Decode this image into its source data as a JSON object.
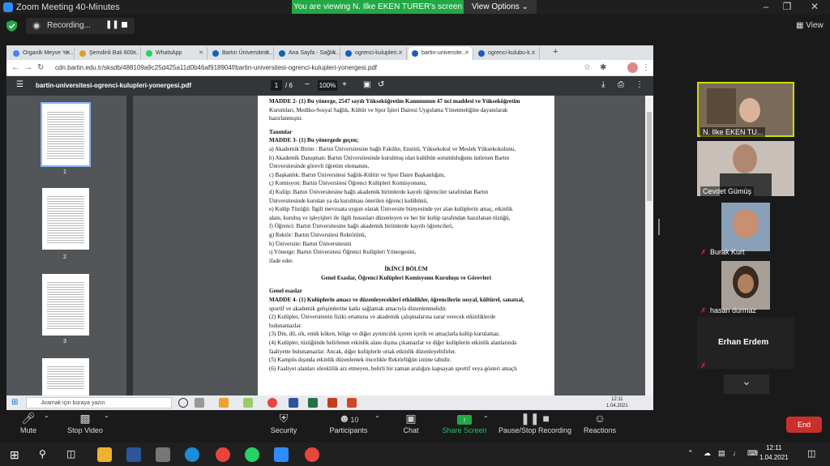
{
  "zoom": {
    "window_title": "Zoom Meeting 40-Minutes",
    "viewing_banner": "You are viewing N. Ilke EKEN TURER's screen",
    "view_options": "View Options ⌄",
    "recording_label": "Recording...",
    "view_button": "View",
    "participants_count": "10",
    "end_button": "End",
    "controls": [
      {
        "label": "Mute",
        "icon": "microphone-icon"
      },
      {
        "label": "Stop Video",
        "icon": "video-camera-icon"
      },
      {
        "label": "Security",
        "icon": "shield-icon"
      },
      {
        "label": "Participants",
        "icon": "participants-icon"
      },
      {
        "label": "Chat",
        "icon": "chat-icon"
      },
      {
        "label": "Share Screen",
        "icon": "share-screen-icon"
      },
      {
        "label": "Pause/Stop Recording",
        "icon": "recording-icon"
      },
      {
        "label": "Reactions",
        "icon": "reactions-icon"
      }
    ],
    "participants": [
      {
        "name": "N. Ilke EKEN TU..."
      },
      {
        "name": "Cevdet Gümüş"
      },
      {
        "name": "Burak Kurt"
      },
      {
        "name": "hasan durmaz"
      },
      {
        "name": "Erhan Erdem"
      }
    ]
  },
  "browser": {
    "tabs": [
      {
        "label": "Organik Meyve Ye...",
        "color": "#4285f4"
      },
      {
        "label": "Şemdinli Balı 800...",
        "color": "#e0a020"
      },
      {
        "label": "WhatsApp",
        "color": "#25d366"
      },
      {
        "label": "Bartın Üniversitesi...",
        "color": "#1a5fb4"
      },
      {
        "label": "Ana Sayfa - Sağlık...",
        "color": "#1a5fb4"
      },
      {
        "label": "ogrenci-kulupleri...",
        "color": "#1a5fb4"
      },
      {
        "label": "bartin-universite...",
        "color": "#1a5fb4"
      },
      {
        "label": "ogrenci-kulubu-k...",
        "color": "#1a5fb4"
      }
    ],
    "url": "cdn.bartin.edu.tr/sksdb/488109a9c25d425a11d0b46af918904f/bartin-universitesi-ogrenci-kulupleri-yonergesi.pdf"
  },
  "pdf": {
    "filename": "bartin-universitesi-ogrenci-kulupleri-yonergesi.pdf",
    "current_page": "1",
    "total_pages": "/ 6",
    "zoom": "100%",
    "thumb_numbers": [
      "1",
      "2",
      "3"
    ],
    "lines": [
      {
        "t": "MADDE 2- (1) Bu yönerge, 2547 sayılı Yükseköğretim Kanununun 47 nci maddesi ve Yükseköğretim",
        "s": "b"
      },
      {
        "t": "Kurumları, Mediko-Sosyal Sağlık, Kültür ve Spor İşleri Dairesi Uygulama Yönetmeliğine dayanılarak",
        "s": ""
      },
      {
        "t": "hazırlanmıştır.",
        "s": ""
      },
      {
        "t": "",
        "s": "gap"
      },
      {
        "t": "Tanımlar",
        "s": "b"
      },
      {
        "t": "MADDE 3- (1) Bu yönergede geçen;",
        "s": "b"
      },
      {
        "t": "a) Akademik Birim : Bartın Üniversitesine bağlı Fakülte, Enstitü, Yüksekokul ve Meslek Yüksekokulunu,",
        "s": ""
      },
      {
        "t": "b) Akademik Danışman: Bartın Üniversitesinde kurulmuş olan kulübün sorumluluğunu üstlenen Bartın",
        "s": ""
      },
      {
        "t": "Üniversitesinde görevli öğretim elemanını,",
        "s": ""
      },
      {
        "t": "c) Başkanlık: Bartın Üniversitesi Sağlık-Kültür ve Spor Daire Başkanlığını,",
        "s": ""
      },
      {
        "t": "ç) Komisyon: Bartın Üniversitesi Öğrenci Kulüpleri Komisyonunu,",
        "s": ""
      },
      {
        "t": "d) Kulüp: Bartın Üniversitesine bağlı akademik birimlerde kayıtlı öğrenciler tarafından Bartın",
        "s": ""
      },
      {
        "t": "Üniversitesinde kurulan ya da kurulması önerilen öğrenci kulübünü,",
        "s": ""
      },
      {
        "t": "e) Kulüp Tüzüğü: İlgili mevzuata uygun olarak Üniversite bünyesinde yer alan kulüplerin amaç, etkinlik",
        "s": ""
      },
      {
        "t": "alanı, kuruluş ve işleyişleri ile ilgili hususları düzenleyen ve her bir kulüp tarafından hazırlanan tüzüğü,",
        "s": ""
      },
      {
        "t": "f) Öğrenci: Bartın Üniversitesine bağlı akademik birimlerde kayıtlı öğrencileri,",
        "s": ""
      },
      {
        "t": "g) Rektör: Bartın Üniversitesi Rektörünü,",
        "s": ""
      },
      {
        "t": "h) Üniversite: Bartın Üniversitesini",
        "s": ""
      },
      {
        "t": "ı) Yönerge: Bartın Üniversitesi Öğrenci Kulüpleri Yönergesini,",
        "s": ""
      },
      {
        "t": "ifade eder.",
        "s": ""
      },
      {
        "t": "İKİNCİ BÖLÜM",
        "s": "c"
      },
      {
        "t": "Genel Esaslar, Öğrenci Kulüpleri Komisyonu Kuruluşu ve Görevleri",
        "s": "c"
      },
      {
        "t": "",
        "s": "gap"
      },
      {
        "t": "Genel esaslar",
        "s": "b"
      },
      {
        "t": "MADDE 4- (1) Kulüplerin amacı ve düzenleyecekleri etkinlikler, öğrencilerin sosyal, kültürel, sanatsal,",
        "s": "b"
      },
      {
        "t": "sportif ve akademik gelişimlerine katkı sağlamak amacıyla düzenlenmelidir.",
        "s": ""
      },
      {
        "t": "(2) Kulüpler, Üniversitenin fiziki ortamına ve akademik çalışmalarına zarar verecek etkinliklerde",
        "s": ""
      },
      {
        "t": "bulunamazlar.",
        "s": ""
      },
      {
        "t": "(3) Din, dil, ırk, etnik köken, bölge ve diğer ayrımcılık içeren içerik ve amaçlarla kulüp kurulamaz.",
        "s": ""
      },
      {
        "t": "(4) Kulüpler, tüzüğünde belirlenen etkinlik alanı dışına çıkamazlar ve diğer kulüplerin etkinlik alanlarında",
        "s": ""
      },
      {
        "t": "faaliyette bulunamazlar. Ancak, diğer kulüplerle ortak etkinlik düzenleyebilirler.",
        "s": ""
      },
      {
        "t": "(5) Kampüs dışında etkinlik düzenlemek öncelikle Rektörlüğün iznine tabidir.",
        "s": ""
      },
      {
        "t": "(6) Faaliyet alanları süreklilik arz etmeyen, belirli bir zaman aralığını kapsayan sportif veya gösteri amaçlı",
        "s": ""
      }
    ]
  },
  "remote_taskbar": {
    "search_placeholder": "Aramak için buraya yazın",
    "time": "12:11",
    "date": "1.04.2021"
  },
  "windows_taskbar": {
    "time": "12:11",
    "date": "1.04.2021"
  }
}
